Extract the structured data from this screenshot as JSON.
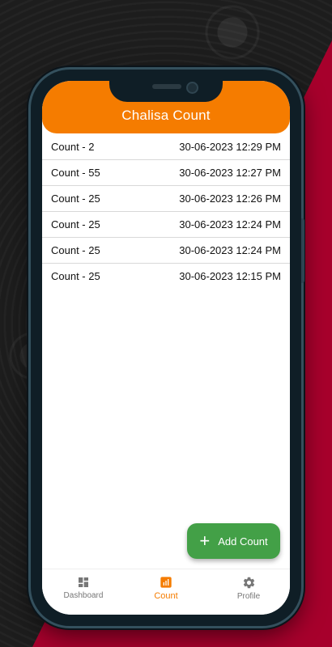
{
  "app": {
    "title": "Chalisa Count"
  },
  "counts": [
    {
      "label": "Count - 2",
      "timestamp": "30-06-2023 12:29 PM"
    },
    {
      "label": "Count - 55",
      "timestamp": "30-06-2023 12:27 PM"
    },
    {
      "label": "Count - 25",
      "timestamp": "30-06-2023 12:26 PM"
    },
    {
      "label": "Count - 25",
      "timestamp": "30-06-2023 12:24 PM"
    },
    {
      "label": "Count - 25",
      "timestamp": "30-06-2023 12:24 PM"
    },
    {
      "label": "Count - 25",
      "timestamp": "30-06-2023 12:15 PM"
    }
  ],
  "fab": {
    "label": "Add Count",
    "icon": "plus-icon"
  },
  "nav": {
    "items": [
      {
        "label": "Dashboard",
        "icon": "dashboard-icon",
        "active": false
      },
      {
        "label": "Count",
        "icon": "bar-chart-icon",
        "active": true
      },
      {
        "label": "Profile",
        "icon": "gear-icon",
        "active": false
      }
    ]
  },
  "colors": {
    "appbar": "#f57c00",
    "fab": "#43a047",
    "active_nav": "#f57c00",
    "inactive_nav": "#777777",
    "background_accent": "#a7002c"
  }
}
